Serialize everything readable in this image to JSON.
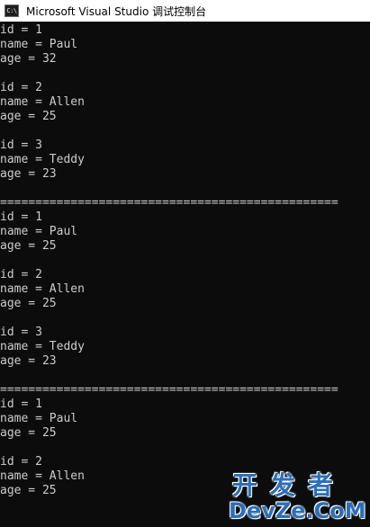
{
  "window": {
    "title": "Microsoft Visual Studio 调试控制台",
    "icon": "console-app-icon",
    "icon_text": "C:\\"
  },
  "console": {
    "lines": [
      "id = 1",
      "name = Paul",
      "age = 32",
      "",
      "id = 2",
      "name = Allen",
      "age = 25",
      "",
      "id = 3",
      "name = Teddy",
      "age = 23",
      "",
      "================================================",
      "id = 1",
      "name = Paul",
      "age = 25",
      "",
      "id = 2",
      "name = Allen",
      "age = 25",
      "",
      "id = 3",
      "name = Teddy",
      "age = 23",
      "",
      "================================================",
      "id = 1",
      "name = Paul",
      "age = 25",
      "",
      "id = 2",
      "name = Allen",
      "age = 25"
    ]
  },
  "watermark": {
    "cn": "开发者",
    "en": "DevZe.CoM"
  },
  "colors": {
    "console_bg": "#0c0c0c",
    "console_fg": "#cccccc",
    "titlebar_bg": "#ffffff",
    "watermark": "#2a6fb8"
  }
}
